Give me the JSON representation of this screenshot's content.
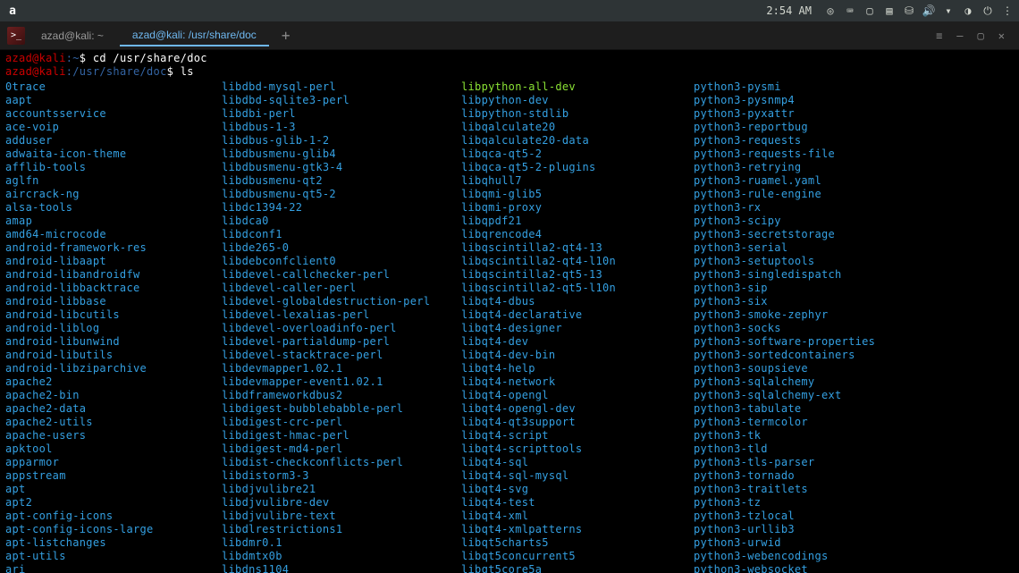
{
  "topbar": {
    "clock": "2:54 AM"
  },
  "tabs": [
    {
      "label": "azad@kali: ~",
      "active": false
    },
    {
      "label": "azad@kali: /usr/share/doc",
      "active": true
    }
  ],
  "tab_add": "+",
  "prompt1": {
    "user": "azad@kali",
    "colon": ":",
    "path": "~",
    "dollar": "$ ",
    "cmd": "cd /usr/share/doc"
  },
  "prompt2": {
    "user": "azad@kali",
    "colon": ":",
    "path": "/usr/share/doc",
    "dollar": "$ ",
    "cmd": "ls"
  },
  "ls": {
    "col1": [
      "0trace",
      "aapt",
      "accountsservice",
      "ace-voip",
      "adduser",
      "adwaita-icon-theme",
      "afflib-tools",
      "aglfn",
      "aircrack-ng",
      "alsa-tools",
      "amap",
      "amd64-microcode",
      "android-framework-res",
      "android-libaapt",
      "android-libandroidfw",
      "android-libbacktrace",
      "android-libbase",
      "android-libcutils",
      "android-liblog",
      "android-libunwind",
      "android-libutils",
      "android-libziparchive",
      "apache2",
      "apache2-bin",
      "apache2-data",
      "apache2-utils",
      "apache-users",
      "apktool",
      "apparmor",
      "appstream",
      "apt",
      "apt2",
      "apt-config-icons",
      "apt-config-icons-large",
      "apt-listchanges",
      "apt-utils",
      "ari"
    ],
    "col2": [
      "libdbd-mysql-perl",
      "libdbd-sqlite3-perl",
      "libdbi-perl",
      "libdbus-1-3",
      "libdbus-glib-1-2",
      "libdbusmenu-glib4",
      "libdbusmenu-gtk3-4",
      "libdbusmenu-qt2",
      "libdbusmenu-qt5-2",
      "libdc1394-22",
      "libdca0",
      "libdconf1",
      "libde265-0",
      "libdebconfclient0",
      "libdevel-callchecker-perl",
      "libdevel-caller-perl",
      "libdevel-globaldestruction-perl",
      "libdevel-lexalias-perl",
      "libdevel-overloadinfo-perl",
      "libdevel-partialdump-perl",
      "libdevel-stacktrace-perl",
      "libdevmapper1.02.1",
      "libdevmapper-event1.02.1",
      "libdframeworkdbus2",
      "libdigest-bubblebabble-perl",
      "libdigest-crc-perl",
      "libdigest-hmac-perl",
      "libdigest-md4-perl",
      "libdist-checkconflicts-perl",
      "libdistorm3-3",
      "libdjvulibre21",
      "libdjvulibre-dev",
      "libdjvulibre-text",
      "libdlrestrictions1",
      "libdmr0.1",
      "libdmtx0b",
      "libdns1104"
    ],
    "col3": [
      {
        "t": "libpython-all-dev",
        "exec": true
      },
      "libpython-dev",
      "libpython-stdlib",
      "libqalculate20",
      "libqalculate20-data",
      "libqca-qt5-2",
      "libqca-qt5-2-plugins",
      "libqhull7",
      "libqmi-glib5",
      "libqmi-proxy",
      "libqpdf21",
      "libqrencode4",
      "libqscintilla2-qt4-13",
      "libqscintilla2-qt4-l10n",
      "libqscintilla2-qt5-13",
      "libqscintilla2-qt5-l10n",
      "libqt4-dbus",
      "libqt4-declarative",
      "libqt4-designer",
      "libqt4-dev",
      "libqt4-dev-bin",
      "libqt4-help",
      "libqt4-network",
      "libqt4-opengl",
      "libqt4-opengl-dev",
      "libqt4-qt3support",
      "libqt4-script",
      "libqt4-scripttools",
      "libqt4-sql",
      "libqt4-sql-mysql",
      "libqt4-svg",
      "libqt4-test",
      "libqt4-xml",
      "libqt4-xmlpatterns",
      "libqt5charts5",
      "libqt5concurrent5",
      "libqt5core5a"
    ],
    "col4": [
      "python3-pysmi",
      "python3-pysnmp4",
      "python3-pyxattr",
      "python3-reportbug",
      "python3-requests",
      "python3-requests-file",
      "python3-retrying",
      "python3-ruamel.yaml",
      "python3-rule-engine",
      "python3-rx",
      "python3-scipy",
      "python3-secretstorage",
      "python3-serial",
      "python3-setuptools",
      "python3-singledispatch",
      "python3-sip",
      "python3-six",
      "python3-smoke-zephyr",
      "python3-socks",
      "python3-software-properties",
      "python3-sortedcontainers",
      "python3-soupsieve",
      "python3-sqlalchemy",
      "python3-sqlalchemy-ext",
      "python3-tabulate",
      "python3-termcolor",
      "python3-tk",
      "python3-tld",
      "python3-tls-parser",
      "python3-tornado",
      "python3-traitlets",
      "python3-tz",
      "python3-tzlocal",
      "python3-urllib3",
      "python3-urwid",
      "python3-webencodings",
      "python3-websocket"
    ]
  }
}
